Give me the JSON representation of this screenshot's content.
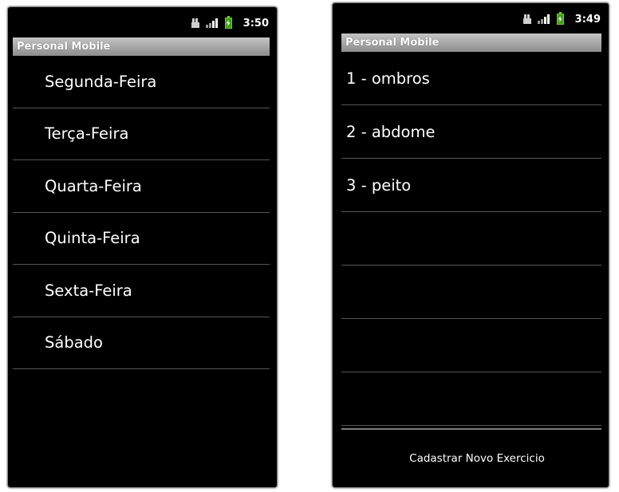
{
  "left_screen": {
    "status_bar": {
      "time": "3:50",
      "icons": [
        "usb-icon",
        "signal-icon",
        "battery-charging-icon"
      ]
    },
    "title": "Personal Mobile",
    "days": [
      "Segunda-Feira",
      "Terça-Feira",
      "Quarta-Feira",
      "Quinta-Feira",
      "Sexta-Feira",
      "Sábado"
    ]
  },
  "right_screen": {
    "status_bar": {
      "time": "3:49",
      "icons": [
        "usb-icon",
        "signal-icon",
        "battery-charging-icon"
      ]
    },
    "title": "Personal Mobile",
    "exercises": [
      "1 - ombros",
      "2 - abdome",
      "3 - peito",
      "",
      "",
      "",
      ""
    ],
    "button_label": "Cadastrar Novo Exercicio"
  },
  "colors": {
    "background": "#000000",
    "title_bar": "#a9a9a9",
    "divider": "#565656",
    "battery": "#3fa012"
  }
}
